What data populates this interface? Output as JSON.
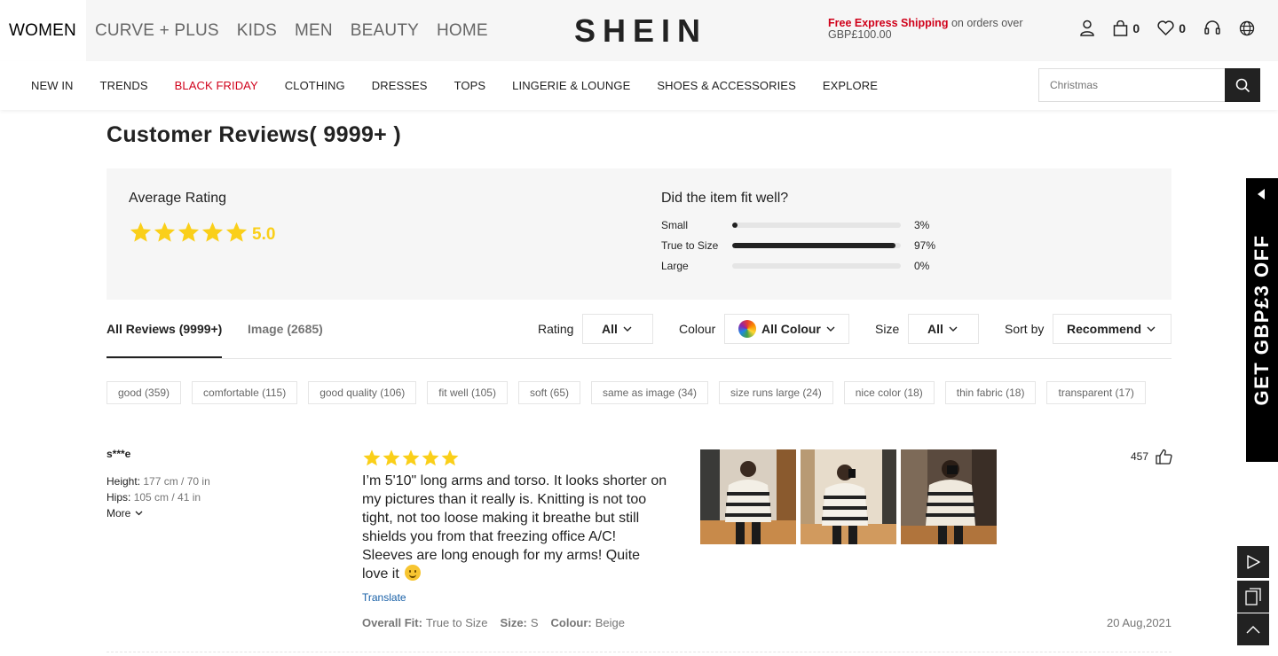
{
  "topbar": {
    "categories": [
      "WOMEN",
      "CURVE + PLUS",
      "KIDS",
      "MEN",
      "BEAUTY",
      "HOME"
    ],
    "logo": "SHEIN",
    "promo_red": "Free Express Shipping",
    "promo_rest": " on orders over GBP£100.00",
    "cart_count": "0",
    "wishlist_count": "0"
  },
  "nav": {
    "items": [
      "NEW IN",
      "TRENDS",
      "BLACK FRIDAY",
      "CLOTHING",
      "DRESSES",
      "TOPS",
      "LINGERIE & LOUNGE",
      "SHOES & ACCESSORIES",
      "EXPLORE"
    ],
    "search_placeholder": "Christmas"
  },
  "reviews": {
    "title": "Customer Reviews( 9999+ )",
    "average_label": "Average Rating",
    "average_value": "5.0",
    "average_stars": 5,
    "fit_title": "Did the item fit well?",
    "fit": [
      {
        "label": "Small",
        "pct_text": "3%",
        "pct": 3
      },
      {
        "label": "True to Size",
        "pct_text": "97%",
        "pct": 97
      },
      {
        "label": "Large",
        "pct_text": "0%",
        "pct": 0
      }
    ]
  },
  "filters": {
    "tab_all": "All Reviews (9999+)",
    "tab_image": "Image (2685)",
    "rating_label": "Rating",
    "rating_value": "All",
    "colour_label": "Colour",
    "colour_value": "All Colour",
    "size_label": "Size",
    "size_value": "All",
    "sort_label": "Sort by",
    "sort_value": "Recommend"
  },
  "tags": [
    "good (359)",
    "comfortable (115)",
    "good quality (106)",
    "fit well (105)",
    "soft (65)",
    "same as image (34)",
    "size runs large (24)",
    "nice color (18)",
    "thin fabric (18)",
    "transparent (17)"
  ],
  "review": {
    "user": "s***e",
    "height_label": "Height:",
    "height_value": "177 cm / 70 in",
    "hips_label": "Hips:",
    "hips_value": "105 cm / 41 in",
    "more_label": "More",
    "stars": 5,
    "text": "I’m 5'10\" long arms and torso. It looks shorter on my pictures than it really is. Knitting is not too tight, not too loose making it breathe but still shields you from that freezing office A/C! Sleeves are long enough for my arms! Quite love it",
    "translate": "Translate",
    "fit_label": "Overall Fit:",
    "fit_value": "True to Size",
    "size_label": "Size:",
    "size_value": "S",
    "colour_label": "Colour:",
    "colour_value": "Beige",
    "helpful_count": "457",
    "date": "20 Aug,2021"
  },
  "side_promo": {
    "text": "GET GBP£3 OFF"
  },
  "colors": {
    "accent_red": "#d0021b",
    "star_yellow": "#facf19",
    "link_blue": "#1860a7"
  }
}
